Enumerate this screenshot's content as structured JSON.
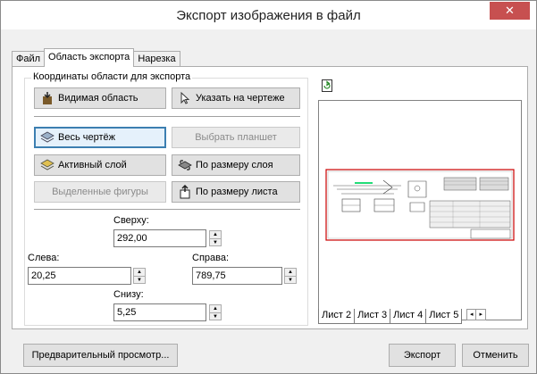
{
  "window": {
    "title": "Экспорт изображения в файл",
    "close_glyph": "✕"
  },
  "tabs": [
    {
      "label": "Файл"
    },
    {
      "label": "Область экспорта"
    },
    {
      "label": "Нарезка"
    }
  ],
  "group": {
    "legend": "Координаты области для экспорта"
  },
  "buttons": {
    "visible_area": "Видимая область",
    "pick_on_drawing": "Указать на чертеже",
    "whole_drawing": "Весь чертёж",
    "choose_tablet": "Выбрать планшет",
    "active_layer": "Активный слой",
    "fit_layer": "По размеру слоя",
    "selected_shapes": "Выделенные фигуры",
    "fit_sheet": "По размеру листа"
  },
  "coords": {
    "top_label": "Сверху:",
    "top_value": "292,00",
    "left_label": "Слева:",
    "left_value": "20,25",
    "right_label": "Справа:",
    "right_value": "789,75",
    "bottom_label": "Снизу:",
    "bottom_value": "5,25"
  },
  "sheets": [
    "Лист 2",
    "Лист 3",
    "Лист 4",
    "Лист 5"
  ],
  "footer": {
    "preview": "Предварительный просмотр...",
    "export": "Экспорт",
    "cancel": "Отменить"
  },
  "colors": {
    "close_bg": "#c75050",
    "selection_frame": "#cc0000",
    "focus_border": "#3c7fb1"
  }
}
